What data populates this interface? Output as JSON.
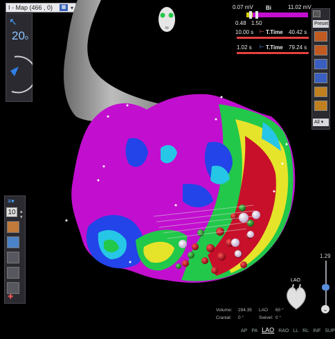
{
  "map_selector": {
    "label": "I - Map (466 , 0)"
  },
  "zoom": {
    "value": "20",
    "unit": "o"
  },
  "left_panel": {
    "number_value": "10"
  },
  "voltage": {
    "min_label": "0.07 mV",
    "signal": "Bi",
    "max_label": "11.02 mV",
    "low_value": "0.48",
    "high_value": "1.50"
  },
  "timing_1": {
    "left_label": "10.00 s",
    "name": "T.Time",
    "right_label": "40.42 s"
  },
  "timing_2": {
    "left_label": "1.02 s",
    "name": "T.Time",
    "right_label": "79.24 s"
  },
  "right_toolbar": {
    "preset_label": "Preset",
    "all_label": "All"
  },
  "slider": {
    "top_value": "1.29"
  },
  "orientation": {
    "label": "LAO"
  },
  "info": {
    "volume_label": "Volume:",
    "volume_value": "294.35",
    "lao_label": "LAO",
    "lao_value": "60 °",
    "cranial_label": "Cranial:",
    "cranial_value": "0 °",
    "swivel_label": "Swivel:",
    "swivel_value": "0 °"
  },
  "views": [
    "AP",
    "PA",
    "LAO",
    "RAO",
    "LL",
    "RL",
    "INF",
    "SUP"
  ],
  "active_view": "LAO",
  "colors": {
    "magenta": "#c30fd0",
    "blue": "#2244e8",
    "cyan": "#26c6e6",
    "green": "#22c84a",
    "yellow": "#e6e42a",
    "red": "#c8102a",
    "accent": "#3f7fe0"
  }
}
